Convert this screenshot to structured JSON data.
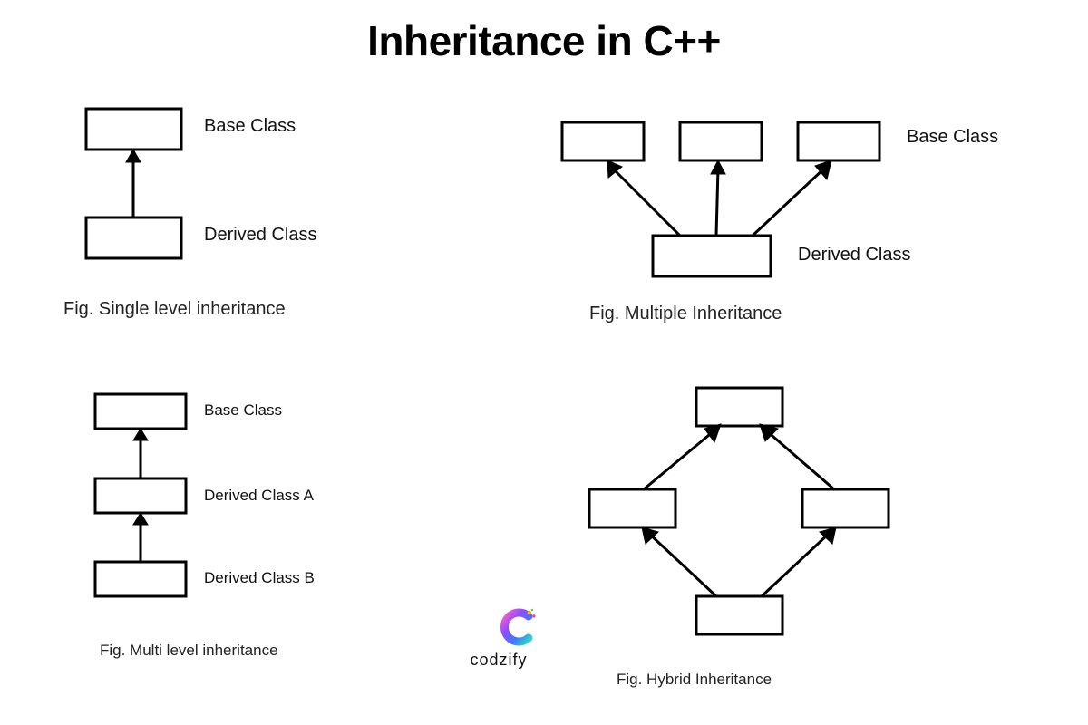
{
  "title": "Inheritance in C++",
  "diagrams": {
    "single": {
      "base_label": "Base Class",
      "derived_label": "Derived Class",
      "caption": "Fig. Single level inheritance"
    },
    "multiple": {
      "base_label": "Base Class",
      "derived_label": "Derived Class",
      "caption": "Fig. Multiple Inheritance"
    },
    "multilevel": {
      "base_label": "Base Class",
      "derived_a_label": "Derived Class A",
      "derived_b_label": "Derived Class B",
      "caption": "Fig. Multi level inheritance"
    },
    "hybrid": {
      "caption": "Fig. Hybrid Inheritance"
    }
  },
  "logo": {
    "text": "codzify"
  }
}
